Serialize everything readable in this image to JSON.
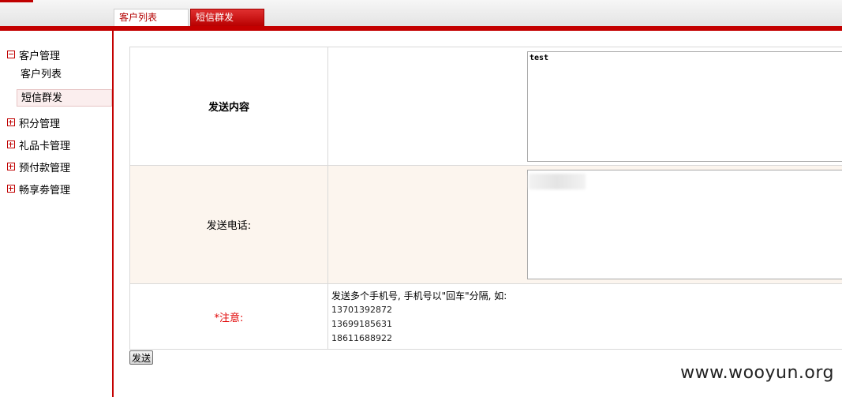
{
  "tabs": [
    {
      "label": "客户列表",
      "active": false
    },
    {
      "label": "短信群发",
      "active": true
    }
  ],
  "sidebar": {
    "groups": [
      {
        "label": "客户管理",
        "expanded": true,
        "items": [
          {
            "label": "客户列表"
          },
          {
            "label": "短信群发",
            "selected": true
          }
        ]
      },
      {
        "label": "积分管理",
        "expanded": false
      },
      {
        "label": "礼品卡管理",
        "expanded": false
      },
      {
        "label": "预付款管理",
        "expanded": false
      },
      {
        "label": "畅享劵管理",
        "expanded": false
      }
    ]
  },
  "form": {
    "content_label": "发送内容",
    "content_value": "test",
    "phone_label": "发送电话:",
    "phone_value": "",
    "note_label": "*注意:",
    "note_text": "发送多个手机号, 手机号以\"回车\"分隔, 如:",
    "examples": [
      "13701392872",
      "13699185631",
      "18611688922"
    ],
    "send_label": "发送"
  },
  "watermark": "www.wooyun.org",
  "colors": {
    "accent": "#c40000",
    "highlight_row": "#fcf5ee",
    "note_red": "#e00000"
  }
}
